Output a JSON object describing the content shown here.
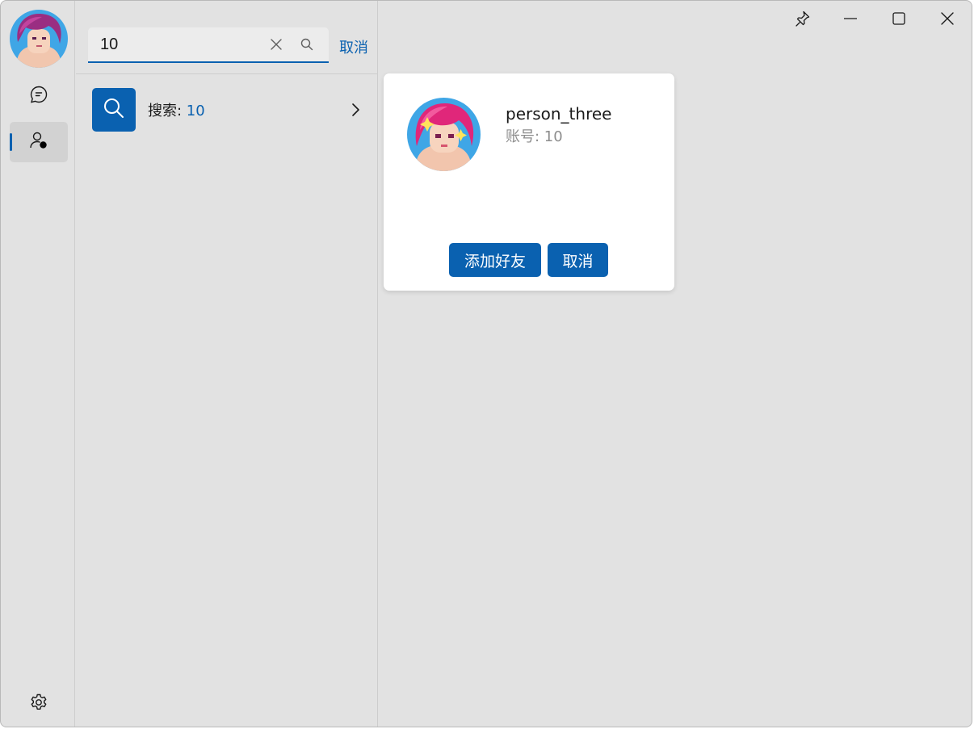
{
  "search": {
    "value": "10",
    "cancel_label": "取消"
  },
  "result": {
    "prefix": "搜索: ",
    "query": "10"
  },
  "profile": {
    "name": "person_three",
    "account_label": "账号: ",
    "account_value": "10",
    "add_friend_label": "添加好友",
    "cancel_label": "取消"
  },
  "icons": {
    "rail": [
      "chat-icon",
      "contacts-icon",
      "settings-icon"
    ],
    "search": [
      "clear-icon",
      "search-icon"
    ],
    "window": [
      "pin-icon",
      "minimize-icon",
      "maximize-icon",
      "close-icon"
    ]
  },
  "colors": {
    "accent": "#0a61b0",
    "window_bg": "#e2e2e2",
    "card_bg": "#ffffff",
    "muted_text": "#8d8d8d"
  }
}
